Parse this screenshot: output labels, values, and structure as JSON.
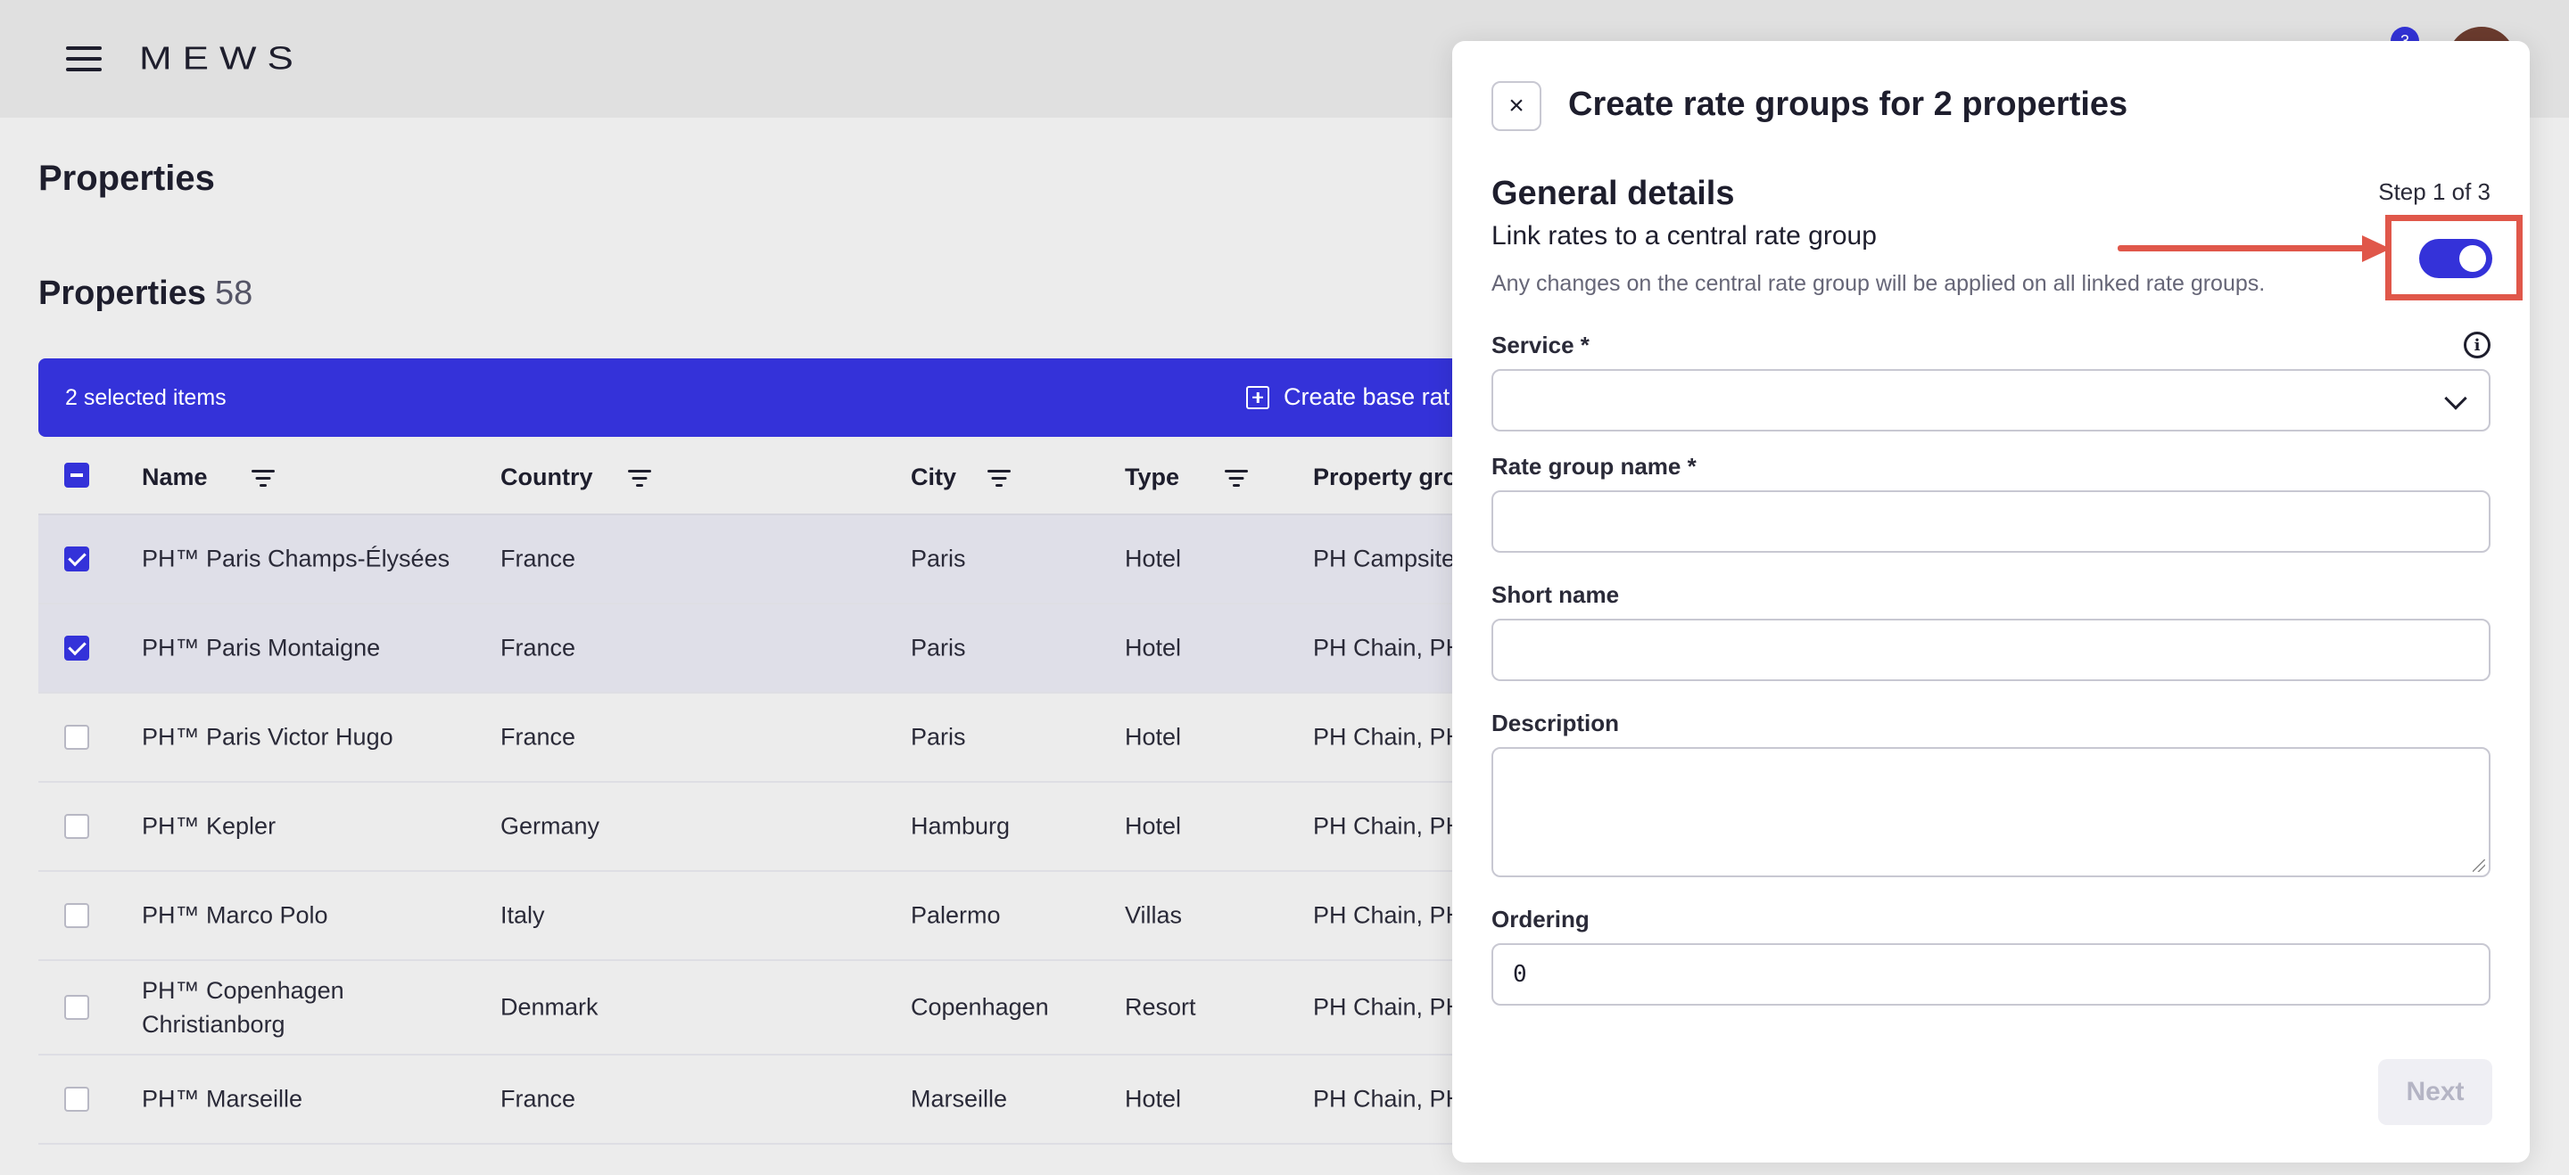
{
  "header": {
    "logo": "MEWS",
    "notification_count": "3"
  },
  "page": {
    "title": "Properties",
    "section_title": "Properties",
    "section_count": "58"
  },
  "selection_bar": {
    "text": "2 selected items",
    "create_base_label": "Create base rat"
  },
  "table": {
    "columns": [
      "Name",
      "Country",
      "City",
      "Type",
      "Property grou"
    ],
    "rows": [
      {
        "checked": true,
        "name": "PH™ Paris Champs-Élysées",
        "country": "France",
        "city": "Paris",
        "type": "Hotel",
        "group": "PH Campsite"
      },
      {
        "checked": true,
        "name": "PH™ Paris Montaigne",
        "country": "France",
        "city": "Paris",
        "type": "Hotel",
        "group": "PH Chain, PH"
      },
      {
        "checked": false,
        "name": "PH™ Paris Victor Hugo",
        "country": "France",
        "city": "Paris",
        "type": "Hotel",
        "group": "PH Chain, PH"
      },
      {
        "checked": false,
        "name": "PH™ Kepler",
        "country": "Germany",
        "city": "Hamburg",
        "type": "Hotel",
        "group": "PH Chain, PH"
      },
      {
        "checked": false,
        "name": "PH™ Marco Polo",
        "country": "Italy",
        "city": "Palermo",
        "type": "Villas",
        "group": "PH Chain, PH"
      },
      {
        "checked": false,
        "name": "PH™ Copenhagen Christianborg",
        "country": "Denmark",
        "city": "Copenhagen",
        "type": "Resort",
        "group": "PH Chain, PH"
      },
      {
        "checked": false,
        "name": "PH™ Marseille",
        "country": "France",
        "city": "Marseille",
        "type": "Hotel",
        "group": "PH Chain, PH"
      }
    ]
  },
  "panel": {
    "title": "Create rate groups for 2 properties",
    "close_symbol": "×",
    "section_title": "General details",
    "step": "Step 1 of 3",
    "link_label": "Link rates to a central rate group",
    "link_hint": "Any changes on the central rate group will be applied on all linked rate groups.",
    "link_enabled": true,
    "fields": {
      "service_label": "Service *",
      "service_value": "",
      "rate_group_name_label": "Rate group name *",
      "rate_group_name_value": "",
      "short_name_label": "Short name",
      "short_name_value": "",
      "description_label": "Description",
      "description_value": "",
      "ordering_label": "Ordering",
      "ordering_value": "0"
    },
    "next_label": "Next"
  },
  "colors": {
    "accent": "#3432d9",
    "highlight": "#e0574a"
  }
}
